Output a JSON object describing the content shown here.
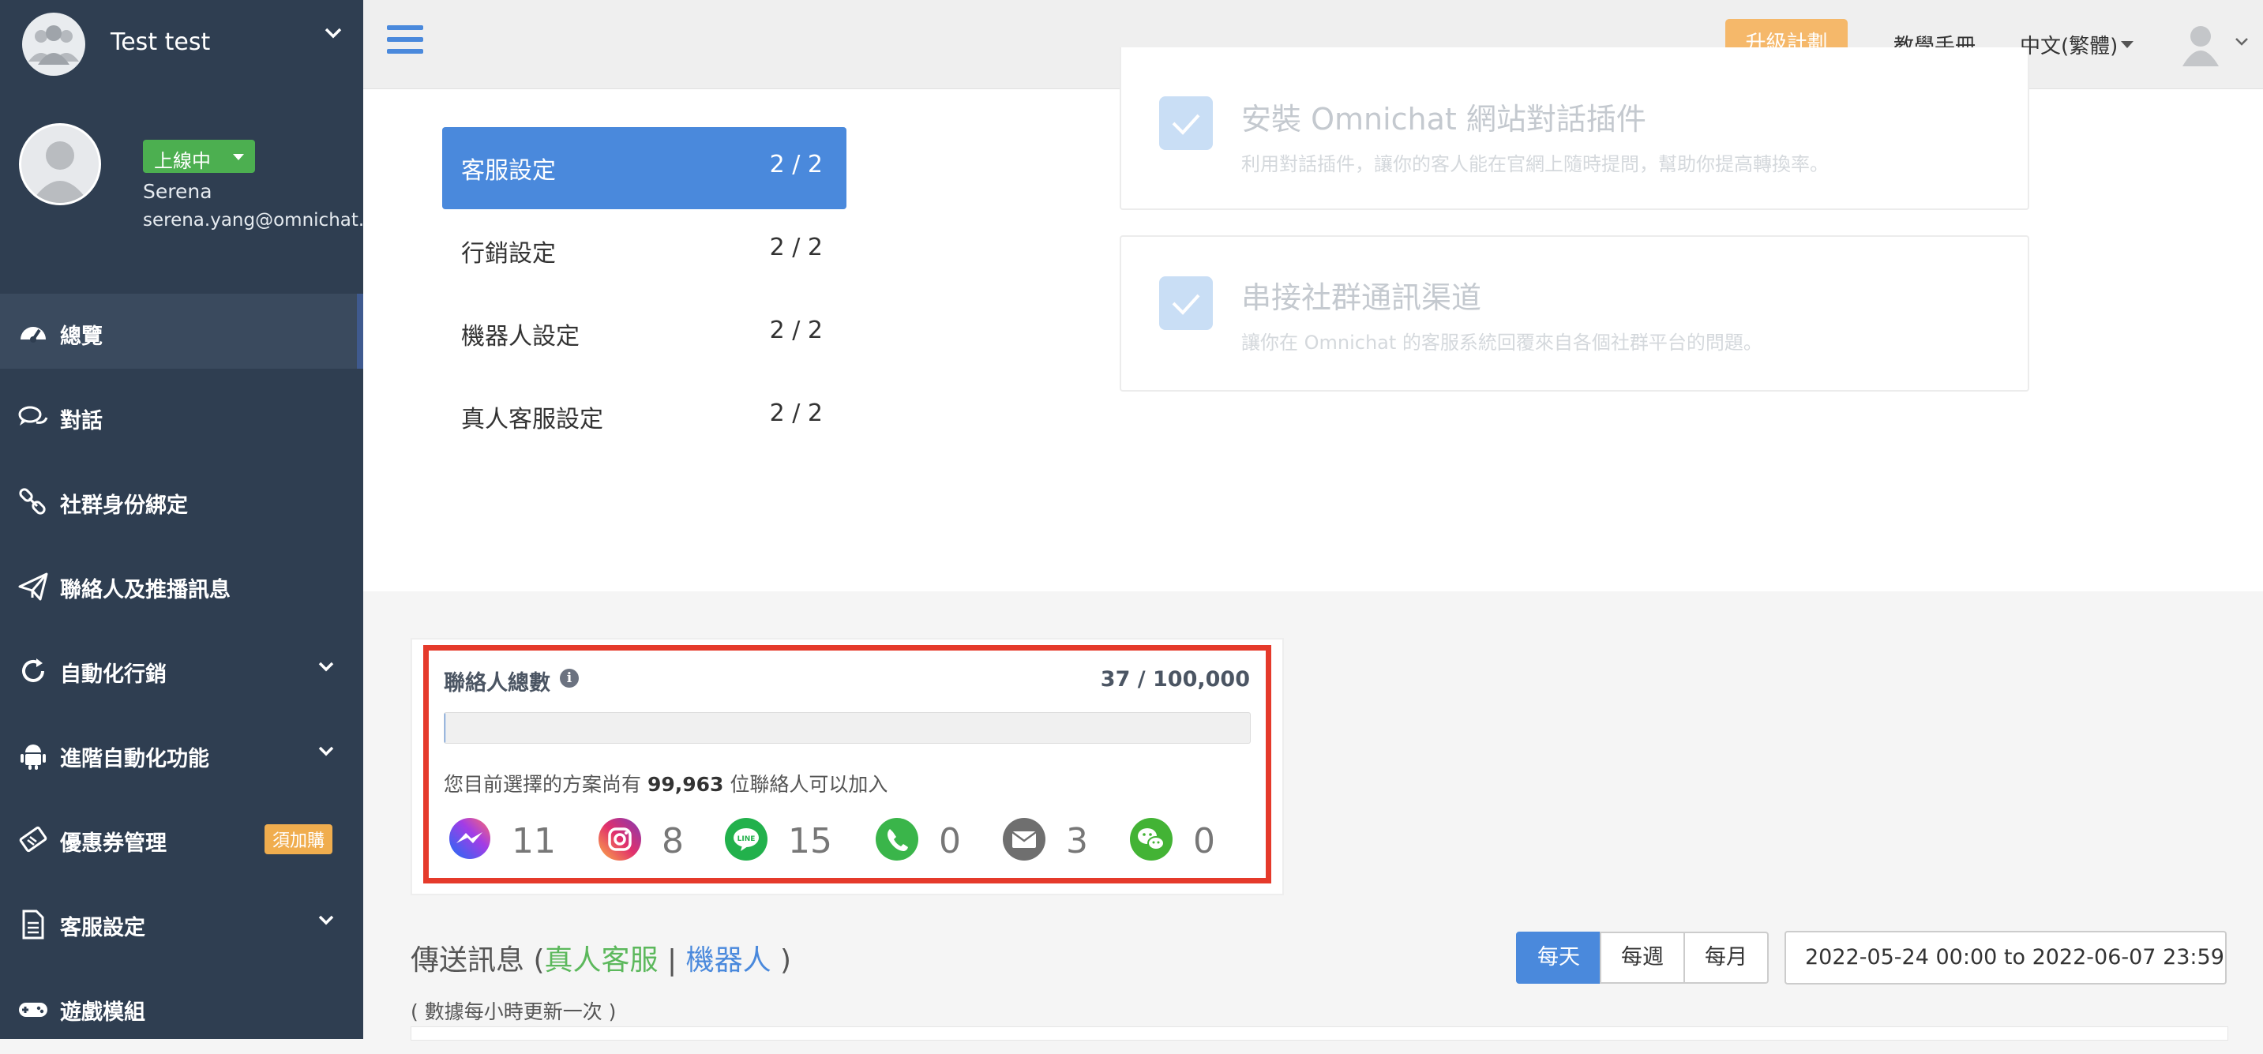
{
  "workspace": {
    "name": "Test test"
  },
  "profile": {
    "status": "上線中",
    "name": "Serena",
    "email": "serena.yang@omnichat.ai"
  },
  "nav": {
    "items": [
      {
        "label": "總覽",
        "icon": "dashboard-icon"
      },
      {
        "label": "對話",
        "icon": "chat-icon"
      },
      {
        "label": "社群身份綁定",
        "icon": "link-icon"
      },
      {
        "label": "聯絡人及推播訊息",
        "icon": "paper-plane-icon"
      },
      {
        "label": "自動化行銷",
        "icon": "refresh-icon"
      },
      {
        "label": "進階自動化功能",
        "icon": "android-icon"
      },
      {
        "label": "優惠券管理",
        "icon": "ticket-icon",
        "badge": "須加購"
      },
      {
        "label": "客服設定",
        "icon": "file-text-icon"
      },
      {
        "label": "遊戲模組",
        "icon": "gamepad-icon"
      }
    ]
  },
  "topbar": {
    "upgrade": "升級計劃",
    "manual": "教學手冊",
    "language": "中文(繁體)"
  },
  "setup": {
    "items": [
      {
        "label": "客服設定",
        "count": "2 / 2"
      },
      {
        "label": "行銷設定",
        "count": "2 / 2"
      },
      {
        "label": "機器人設定",
        "count": "2 / 2"
      },
      {
        "label": "真人客服設定",
        "count": "2 / 2"
      }
    ],
    "tasks": [
      {
        "title": "安裝 Omnichat 網站對話插件",
        "desc": "利用對話插件，讓你的客人能在官網上隨時提問，幫助你提高轉換率。"
      },
      {
        "title": "串接社群通訊渠道",
        "desc": "讓你在 Omnichat 的客服系統回覆來自各個社群平台的問題。"
      }
    ]
  },
  "contacts": {
    "title": "聯絡人總數",
    "count": "37 / 100,000",
    "usage_fraction": 0.00037,
    "remain_prefix": "您目前選擇的方案尚有",
    "remain_value": "99,963",
    "remain_suffix": "位聯絡人可以加入",
    "channels": [
      {
        "name": "messenger-icon",
        "count": "11"
      },
      {
        "name": "instagram-icon",
        "count": "8"
      },
      {
        "name": "line-icon",
        "count": "15"
      },
      {
        "name": "whatsapp-icon",
        "count": "0"
      },
      {
        "name": "email-icon",
        "count": "3"
      },
      {
        "name": "wechat-icon",
        "count": "0"
      }
    ]
  },
  "messages": {
    "title": "傳送訊息",
    "open": "(",
    "human": "真人客服",
    "sep": "|",
    "robot": "機器人",
    "close": ")",
    "note": "( 數據每小時更新一次 )",
    "periods": [
      "每天",
      "每週",
      "每月"
    ],
    "selected_period": "每天",
    "date_range": "2022-05-24 00:00 to 2022-06-07 23:59"
  },
  "colors": {
    "primary": "#4a89dc",
    "sidebar": "#2f3e51",
    "upgrade": "#f5b86a",
    "success": "#4caf50",
    "highlight": "#e53a2b"
  }
}
